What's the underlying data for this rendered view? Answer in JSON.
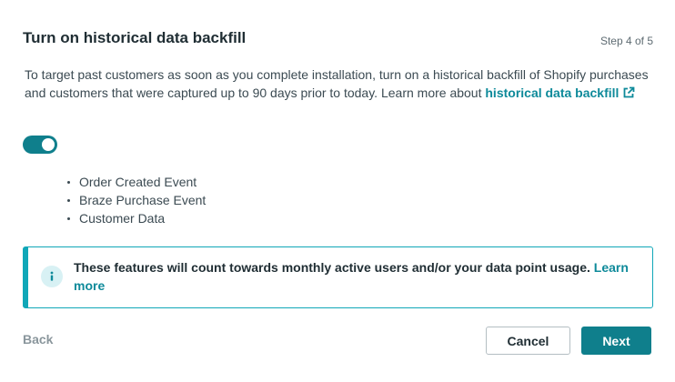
{
  "header": {
    "title": "Turn on historical data backfill",
    "step": "Step 4 of 5"
  },
  "description": {
    "text": "To target past customers as soon as you complete installation, turn on a historical backfill of Shopify purchases and customers that were captured up to 90 days prior to today. Learn more about ",
    "link_label": "historical data backfill"
  },
  "toggle": {
    "state": "on"
  },
  "features": [
    "Order Created Event",
    "Braze Purchase Event",
    "Customer Data"
  ],
  "notice": {
    "text": "These features will count towards monthly active users and/or your data point usage. ",
    "link_label": "Learn more"
  },
  "footer": {
    "back_label": "Back",
    "cancel_label": "Cancel",
    "next_label": "Next"
  },
  "colors": {
    "accent": "#0f7f8c",
    "link": "#0e8a9a",
    "info_border": "#10a7b8"
  }
}
